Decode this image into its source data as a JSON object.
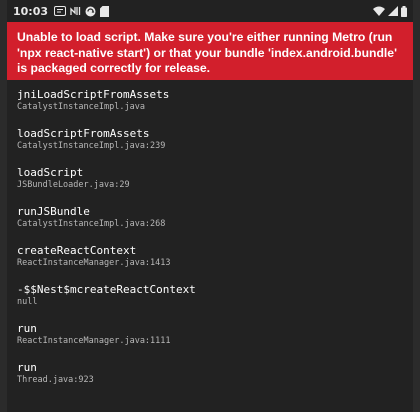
{
  "status_bar": {
    "time": "10:03",
    "icons": [
      "message-icon",
      "nfc-icon",
      "sync-icon",
      "sd-card-icon",
      "wifi-icon",
      "signal-icon",
      "battery-icon"
    ]
  },
  "error_banner": {
    "message": "Unable to load script. Make sure you're either running Metro (run 'npx react-native start') or that your bundle 'index.android.bundle' is packaged correctly for release.",
    "background_color": "#d21f2c"
  },
  "stack_trace": [
    {
      "method": "jniLoadScriptFromAssets",
      "location": "CatalystInstanceImpl.java"
    },
    {
      "method": "loadScriptFromAssets",
      "location": "CatalystInstanceImpl.java:239"
    },
    {
      "method": "loadScript",
      "location": "JSBundleLoader.java:29"
    },
    {
      "method": "runJSBundle",
      "location": "CatalystInstanceImpl.java:268"
    },
    {
      "method": "createReactContext",
      "location": "ReactInstanceManager.java:1413"
    },
    {
      "method": "-$$Nest$mcreateReactContext",
      "location": "null"
    },
    {
      "method": "run",
      "location": "ReactInstanceManager.java:1111"
    },
    {
      "method": "run",
      "location": "Thread.java:923"
    }
  ]
}
